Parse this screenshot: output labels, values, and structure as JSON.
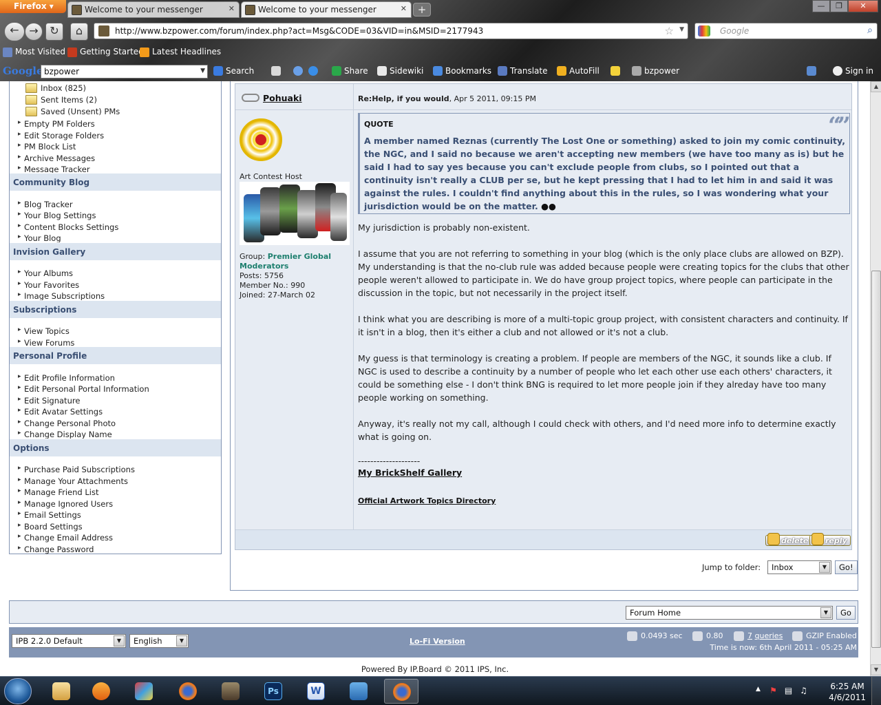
{
  "browser": {
    "app_button": "Firefox",
    "tabs": [
      {
        "title": "Welcome to your messenger"
      },
      {
        "title": "Welcome to your messenger"
      }
    ],
    "url": "http://www.bzpower.com/forum/index.php?act=Msg&CODE=03&VID=in&MSID=2177943",
    "search_placeholder": "Google",
    "bookmarks": [
      "Most Visited",
      "Getting Started",
      "Latest Headlines"
    ],
    "google_toolbar": {
      "logo": "Google",
      "query": "bzpower",
      "items": [
        "Search",
        "Share",
        "Sidewiki",
        "Bookmarks",
        "Translate",
        "AutoFill",
        "bzpower",
        "Sign in"
      ]
    }
  },
  "sidebar": {
    "folders": [
      {
        "label": "Inbox (825)"
      },
      {
        "label": "Sent Items (2)"
      },
      {
        "label": "Saved (Unsent) PMs"
      }
    ],
    "pm_links": [
      "Empty PM Folders",
      "Edit Storage Folders",
      "PM Block List",
      "Archive Messages",
      "Message Tracker"
    ],
    "sections": [
      {
        "title": "Community Blog",
        "items": [
          "Blog Tracker",
          "Your Blog Settings",
          "Content Blocks Settings",
          "Your Blog"
        ]
      },
      {
        "title": "Invision Gallery",
        "items": [
          "Your Albums",
          "Your Favorites",
          "Image Subscriptions"
        ]
      },
      {
        "title": "Subscriptions",
        "items": [
          "View Topics",
          "View Forums"
        ]
      },
      {
        "title": "Personal Profile",
        "items": [
          "Edit Profile Information",
          "Edit Personal Portal Information",
          "Edit Signature",
          "Edit Avatar Settings",
          "Change Personal Photo",
          "Change Display Name"
        ]
      },
      {
        "title": "Options",
        "items": [
          "Purchase Paid Subscriptions",
          "Manage Your Attachments",
          "Manage Friend List",
          "Manage Ignored Users",
          "Email Settings",
          "Board Settings",
          "Change Email Address",
          "Change Password"
        ]
      }
    ]
  },
  "post": {
    "author": "Pohuaki",
    "title": "Re:Help, if you would",
    "date": ", Apr 5 2011, 09:15 PM",
    "author_title": "Art Contest Host",
    "group_label": "Group: ",
    "group_name": "Premier Global Moderators",
    "posts": "Posts: 5756",
    "member_no": "Member No.: 990",
    "joined": "Joined: 27-March 02",
    "quote_header": "QUOTE",
    "quote_text": "A member named Reznas (currently The Lost One or something) asked to join my comic continuity, the NGC, and I said no because we aren't accepting new members (we have too many as is) but he said I had to say yes because you can't exclude people from clubs, so I pointed out that a continuity isn't really a CLUB per se, but he kept pressing that I had to let him in and said it was against the rules. I couldn't find anything about this in the rules, so I was wondering what your jurisdiction would be on the matter.",
    "paragraphs": [
      "My jurisdiction is probably non-existent.",
      "I assume that you are not referring to something in your blog (which is the only place clubs are allowed on BZP). My understanding is that the no-club rule was added because people were creating topics for the clubs that other people weren't allowed to participate in. We do have group project topics, where people can participate in the discussion in the topic, but not necessarily in the project itself.",
      "I think what you are describing is more of a multi-topic group project, with consistent characters and continuity. If it isn't in a blog, then it's either a club and not allowed or it's not a club.",
      "My guess is that terminology is creating a problem. If people are members of the NGC, it sounds like a club. If NGC is used to describe a continuity by a number of people who let each other use each others' characters, it could be something else - I don't think BNG is required to let more people join if they alreday have too many people working on something.",
      "Anyway, it's really not my call, although I could check with others, and I'd need more info to determine exactly what is going on."
    ],
    "sig_dashes": "--------------------",
    "sig_link": "My BrickShelf Gallery",
    "sig_link2": "Official Artwork Topics Directory",
    "delete_label": "delete",
    "reply_label": "reply"
  },
  "jump": {
    "label": "Jump to folder:",
    "selected": "Inbox",
    "go": "Go!"
  },
  "forum_jump": {
    "selected": "Forum Home",
    "go": "Go"
  },
  "footer": {
    "skin": "IPB 2.2.0 Default",
    "language": "English",
    "lofi": "Lo-Fi Version",
    "exec_time": "0.0493 sec",
    "load": "0.80",
    "queries_count": "7",
    "queries_label": "queries",
    "gzip": "GZIP Enabled",
    "time_now": "Time is now: 6th April 2011 - 05:25 AM",
    "powered": "Powered By IP.Board © 2011  IPS, Inc."
  },
  "taskbar": {
    "time": "6:25 AM",
    "date": "4/6/2011"
  }
}
